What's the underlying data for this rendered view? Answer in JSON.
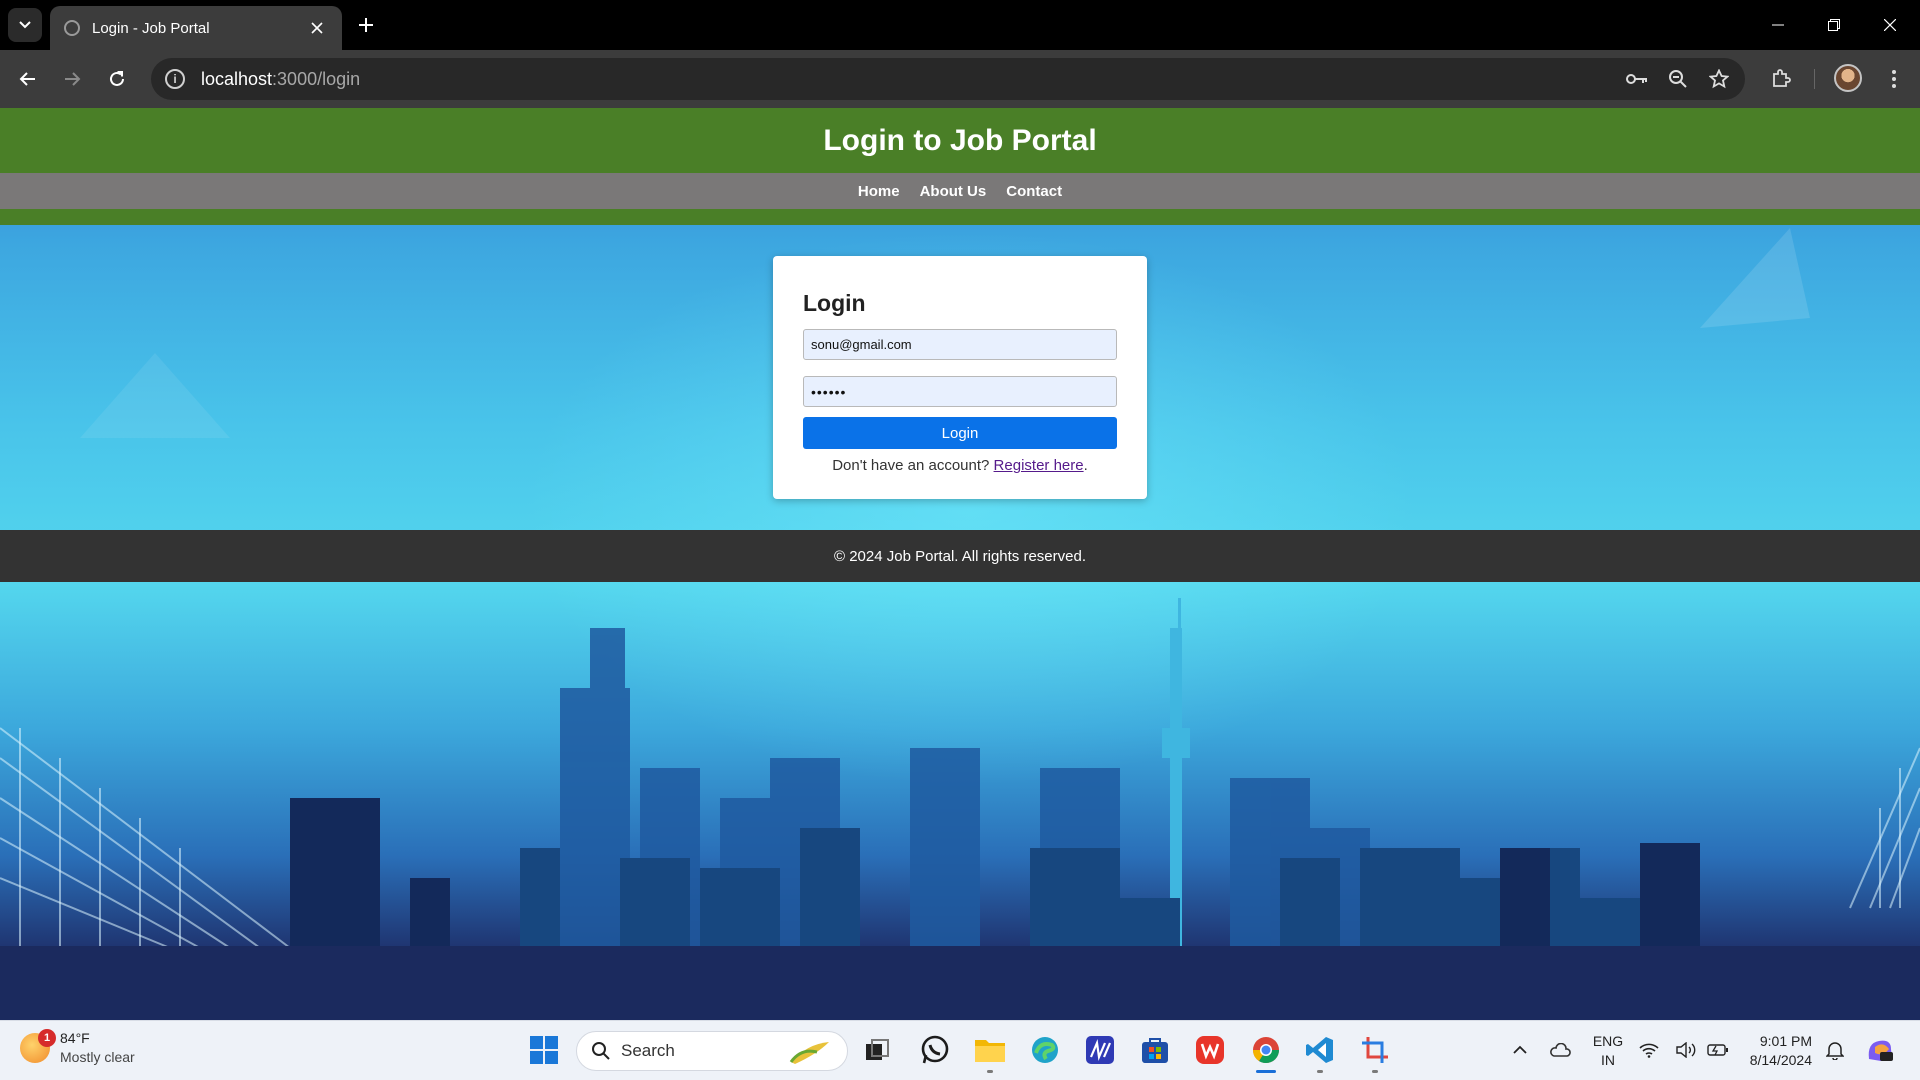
{
  "browser": {
    "tab_title": "Login - Job Portal",
    "url_host": "localhost",
    "url_path": ":3000/login"
  },
  "site": {
    "header_title": "Login to Job Portal",
    "nav": [
      "Home",
      "About Us",
      "Contact"
    ],
    "footer_text": "© 2024 Job Portal. All rights reserved."
  },
  "login": {
    "heading": "Login",
    "email_value": "sonu@gmail.com",
    "password_value": "••••••",
    "button_label": "Login",
    "register_prompt": "Don't have an account?",
    "register_link": "Register here",
    "register_suffix": "."
  },
  "taskbar": {
    "weather_badge": "1",
    "weather_temp": "84°F",
    "weather_condition": "Mostly clear",
    "search_label": "Search",
    "lang_top": "ENG",
    "lang_bottom": "IN",
    "time": "9:01 PM",
    "date": "8/14/2024"
  },
  "colors": {
    "header_green": "#4a7f27",
    "nav_gray": "#7a7878",
    "button_blue": "#0a72e8",
    "footer_dark": "#333333"
  }
}
